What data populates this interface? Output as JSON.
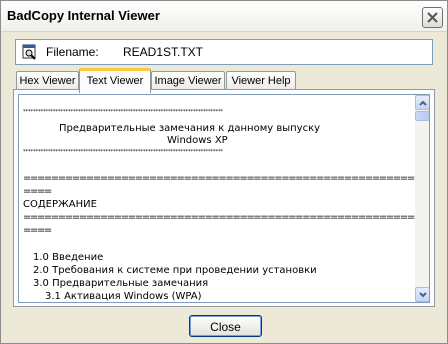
{
  "window": {
    "title": "BadCopy Internal Viewer"
  },
  "file": {
    "label": "Filename:",
    "name": "READ1ST.TXT",
    "icon": "magnifier-document-icon"
  },
  "tabs": [
    {
      "label": "Hex Viewer",
      "active": false
    },
    {
      "label": "Text Viewer",
      "active": true
    },
    {
      "label": "Image Viewer",
      "active": false
    },
    {
      "label": "Viewer Help",
      "active": false
    }
  ],
  "text_viewer": {
    "stars": "********************************************************************************",
    "heading_1": "Предварительные замечания к данному выпуску",
    "heading_2": "Windows XP",
    "rule": "====================================================================",
    "rule_tail": "====",
    "contents": "СОДЕРЖАНИЕ",
    "items": [
      "1.0 Введение",
      "2.0 Требования к системе при проведении установки",
      "3.0 Предварительные замечания",
      "3.1 Активация Windows (WPA)"
    ]
  },
  "buttons": {
    "close": "Close"
  },
  "colors": {
    "tab_highlight": "#ffc83c",
    "border": "#7f9db9"
  }
}
